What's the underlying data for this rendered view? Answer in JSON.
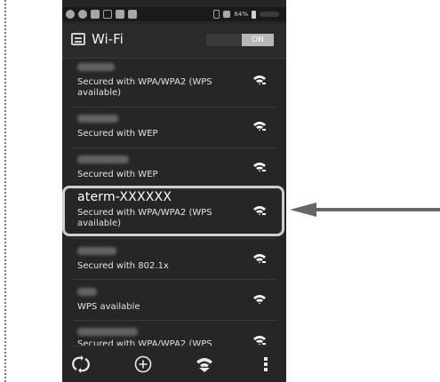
{
  "statusbar": {
    "battery_text": "64%"
  },
  "actionbar": {
    "title": "Wi-Fi",
    "toggle_label": "ON"
  },
  "networks": [
    {
      "security": "Secured with WPA/WPA2 (WPS available)"
    },
    {
      "security": "Secured with WEP"
    },
    {
      "security": "Secured with WEP"
    },
    {
      "name": "aterm-XXXXXX",
      "security": "Secured with WPA/WPA2 (WPS available)"
    },
    {
      "security": "Secured with 802.1x"
    },
    {
      "security": "WPS available"
    },
    {
      "security": "Secured with WPA/WPA2 (WPS"
    }
  ],
  "bottombar": {
    "icons": [
      "wps-push-icon",
      "add-network-icon",
      "wifi-direct-icon",
      "overflow-menu-icon"
    ]
  },
  "colors": {
    "background": "#262626",
    "highlight": "#cfcfcf",
    "arrow": "#666666"
  }
}
